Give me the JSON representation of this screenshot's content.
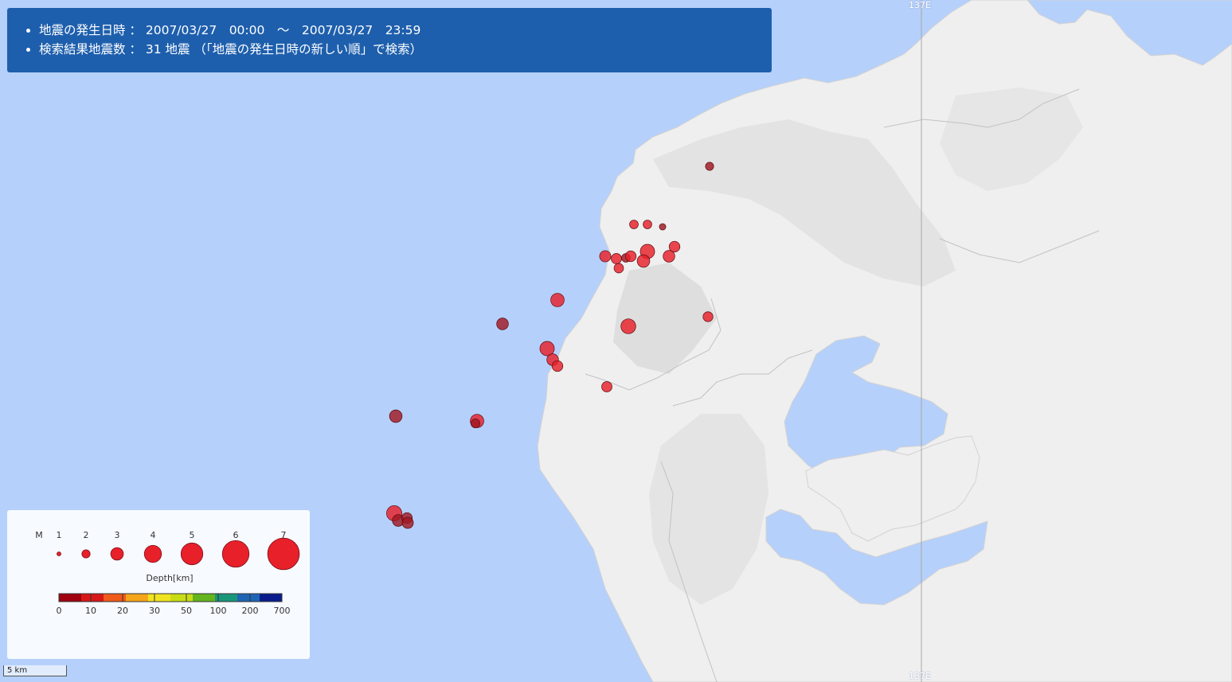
{
  "info": {
    "line1": "地震の発生日時 ： 2007/03/27　00:00　～　2007/03/27　23:59",
    "line2": "検索結果地震数 ： 31 地震 （「地震の発生日時の新しい順」で検索）"
  },
  "meridian": {
    "label_top": "137E",
    "label_bottom": "137E"
  },
  "legend": {
    "m_label": "M",
    "magnitudes": [
      {
        "label": "1",
        "m": 1
      },
      {
        "label": "2",
        "m": 2
      },
      {
        "label": "3",
        "m": 3
      },
      {
        "label": "4",
        "m": 4
      },
      {
        "label": "5",
        "m": 5
      },
      {
        "label": "6",
        "m": 6
      },
      {
        "label": "7",
        "m": 7
      }
    ],
    "depth_title": "Depth[km]",
    "depth_ticks": [
      "0",
      "10",
      "20",
      "30",
      "50",
      "100",
      "200",
      "700"
    ],
    "depth_colors": [
      "#a00010",
      "#d81818",
      "#f05a1a",
      "#f5a51c",
      "#f0e420",
      "#c8dc14",
      "#64b41e",
      "#18967a",
      "#1e64b4",
      "#0a1c8c"
    ]
  },
  "scale": {
    "label": "5 km"
  },
  "colors": {
    "sea": "#b5d0fb",
    "land": "#efefef",
    "land_relief": "#e2e2e2",
    "info_bg": "#1e5fad",
    "quake_shallow": "#e8202a",
    "quake_deep": "#a01822"
  }
}
